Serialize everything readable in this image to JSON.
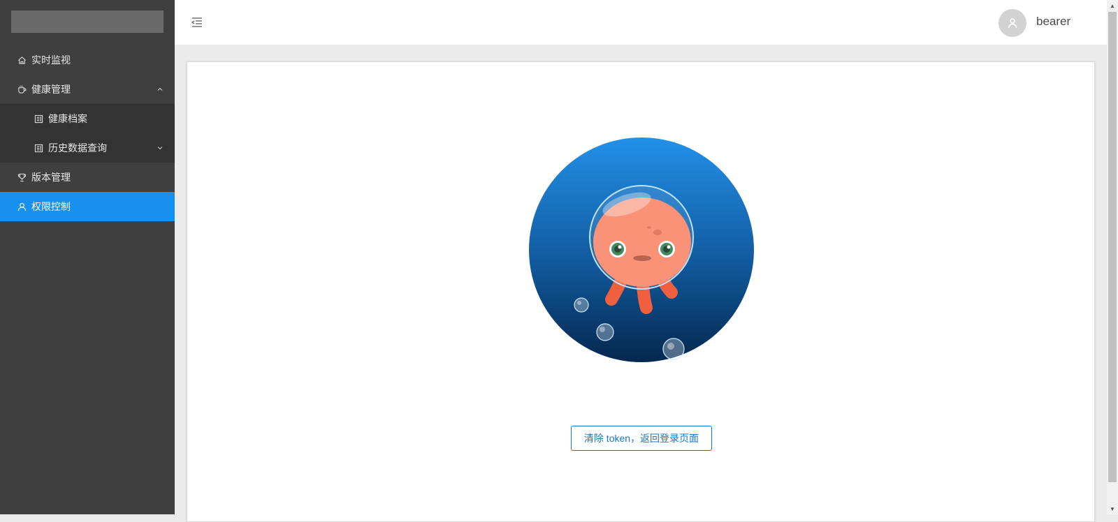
{
  "sidebar": {
    "items": [
      {
        "label": "实时监视",
        "icon": "home-icon"
      },
      {
        "label": "健康管理",
        "icon": "cup-icon",
        "expanded": true,
        "children": [
          {
            "label": "健康档案",
            "icon": "document-icon"
          },
          {
            "label": "历史数据查询",
            "icon": "document-icon",
            "has_children": true
          }
        ]
      },
      {
        "label": "版本管理",
        "icon": "trophy-icon"
      },
      {
        "label": "权限控制",
        "icon": "user-icon",
        "active": true
      }
    ]
  },
  "header": {
    "username": "bearer"
  },
  "main": {
    "button_label": "清除 token，返回登录页面"
  },
  "colors": {
    "sidebar_bg": "#3f3f3f",
    "submenu_bg": "#333333",
    "active": "#1890ef",
    "button_text": "#1677c8"
  }
}
